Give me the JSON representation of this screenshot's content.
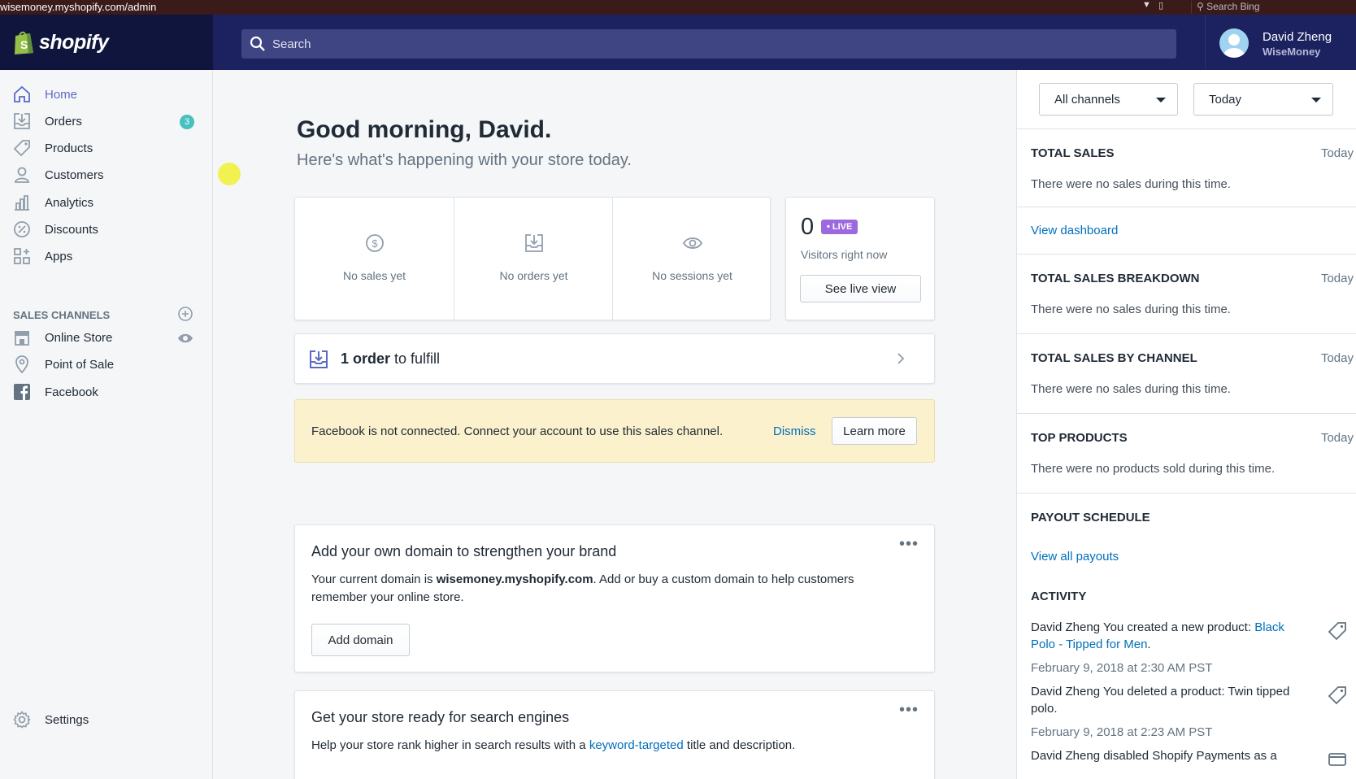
{
  "browser": {
    "url": "wisemoney.myshopify.com/admin",
    "search_placeholder": "Search Bing"
  },
  "topbar": {
    "logo_text": "shopify",
    "search_placeholder": "Search",
    "user_name": "David Zheng",
    "store_name": "WiseMoney",
    "colors": {
      "bar": "#1c2260",
      "logo_area": "#0f153c",
      "search": "#3f4583"
    }
  },
  "sidebar": {
    "items": [
      {
        "label": "Home",
        "icon": "home-icon",
        "active": true
      },
      {
        "label": "Orders",
        "icon": "orders-icon",
        "badge": "3"
      },
      {
        "label": "Products",
        "icon": "tag-icon"
      },
      {
        "label": "Customers",
        "icon": "person-icon"
      },
      {
        "label": "Analytics",
        "icon": "bar-chart-icon"
      },
      {
        "label": "Discounts",
        "icon": "discount-icon"
      },
      {
        "label": "Apps",
        "icon": "apps-icon"
      }
    ],
    "channels_title": "SALES CHANNELS",
    "channels": [
      {
        "label": "Online Store",
        "icon": "store-icon"
      },
      {
        "label": "Point of Sale",
        "icon": "location-pin-icon"
      },
      {
        "label": "Facebook",
        "icon": "facebook-icon"
      }
    ],
    "settings_label": "Settings"
  },
  "main": {
    "greeting": "Good morning, David.",
    "subgreeting": "Here's what's happening with your store today.",
    "stats": [
      {
        "label": "No sales yet",
        "icon": "dollar-icon"
      },
      {
        "label": "No orders yet",
        "icon": "orders-icon"
      },
      {
        "label": "No sessions yet",
        "icon": "eye-icon"
      }
    ],
    "live": {
      "count": "0",
      "badge": "• LIVE",
      "subtitle": "Visitors right now",
      "button": "See live view"
    },
    "fulfill": {
      "count_text": "1 order",
      "rest_text": " to fulfill"
    },
    "banner": {
      "message": "Facebook is not connected. Connect your account to use this sales channel.",
      "dismiss": "Dismiss",
      "learn_more": "Learn more"
    },
    "domain_card": {
      "title": "Add your own domain to strengthen your brand",
      "text_prefix": "Your current domain is ",
      "domain": "wisemoney.myshopify.com",
      "text_suffix": ". Add or buy a custom domain to help customers remember your online store.",
      "button": "Add domain",
      "menu": "•••"
    },
    "seo_card": {
      "title": "Get your store ready for search engines",
      "text_prefix": "Help your store rank higher in search results with a ",
      "link": "keyword-targeted",
      "text_suffix": " title and description.",
      "menu": "•••"
    }
  },
  "right": {
    "channel_select": "All channels",
    "date_select": "Today",
    "sections": [
      {
        "title": "TOTAL SALES",
        "range": "Today",
        "text": "There were no sales during this time."
      },
      {
        "title": "TOTAL SALES BREAKDOWN",
        "range": "Today",
        "text": "There were no sales during this time."
      },
      {
        "title": "TOTAL SALES BY CHANNEL",
        "range": "Today",
        "text": "There were no sales during this time."
      },
      {
        "title": "TOP PRODUCTS",
        "range": "Today",
        "text": "There were no products sold during this time."
      }
    ],
    "view_dashboard": "View dashboard",
    "payout_title": "PAYOUT SCHEDULE",
    "view_payouts": "View all payouts",
    "activity_title": "ACTIVITY",
    "activity": [
      {
        "text": "David Zheng You created a new product: ",
        "link": "Black Polo - Tipped for Men",
        "end": ".",
        "date": "February 9, 2018 at 2:30 AM PST"
      },
      {
        "text": "David Zheng You deleted a product: Twin tipped polo.",
        "date": "February 9, 2018 at 2:23 AM PST"
      },
      {
        "text": "David Zheng disabled Shopify Payments as a"
      }
    ]
  }
}
